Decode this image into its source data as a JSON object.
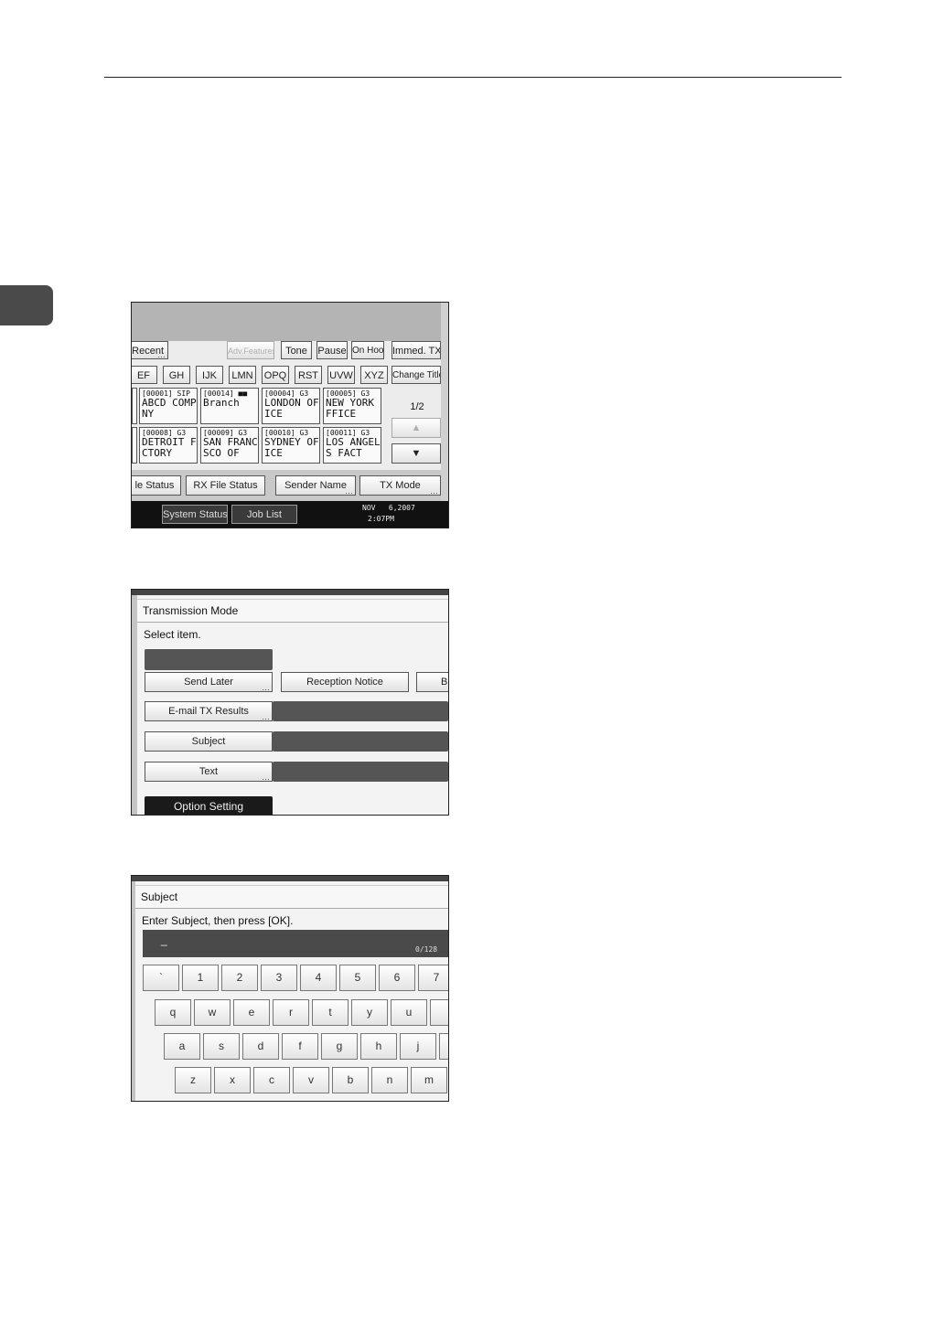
{
  "screen1": {
    "tabs": [
      "Recent",
      "Adv.Features",
      "Tone",
      "Pause",
      "On Hook",
      "Immed. TX"
    ],
    "letters": [
      "EF",
      "GH",
      "IJK",
      "LMN",
      "OPQ",
      "RST",
      "UVW",
      "XYZ",
      "Change Title"
    ],
    "destinations": [
      {
        "code": "[00001] SIP",
        "name1": "ABCD COMPA",
        "name2": "NY"
      },
      {
        "code": "[00014]",
        "name1": "Branch",
        "name2": ""
      },
      {
        "code": "[00004] G3",
        "name1": "LONDON OFF",
        "name2": "ICE"
      },
      {
        "code": "[00005] G3",
        "name1": "NEW YORK O",
        "name2": "FFICE"
      },
      {
        "code": "[00008] G3",
        "name1": "DETROIT FA",
        "name2": "CTORY"
      },
      {
        "code": "[00009] G3",
        "name1": "SAN FRANCI",
        "name2": "SCO OF"
      },
      {
        "code": "[00010] G3",
        "name1": "SYDNEY OFF",
        "name2": "ICE"
      },
      {
        "code": "[00011] G3",
        "name1": "LOS ANGELE",
        "name2": "S FACT"
      }
    ],
    "page_indicator": "1/2",
    "bottom_buttons": [
      "le Status",
      "RX File Status",
      "Sender Name",
      "TX Mode"
    ],
    "footer_buttons": [
      "System Status",
      "Job List"
    ],
    "date": "NOV   6,2007",
    "time": "2:07PM"
  },
  "screen2": {
    "title": "Transmission Mode",
    "instruction": "Select item.",
    "send_later": "Send Later",
    "reception_notice": "Reception Notice",
    "partial": "B",
    "email_tx_results": "E-mail TX Results",
    "subject": "Subject",
    "text": "Text",
    "option_setting": "Option Setting"
  },
  "screen3": {
    "title": "Subject",
    "instruction": "Enter Subject, then press [OK].",
    "cursor": "_",
    "counter": "0/128",
    "row1": [
      "`",
      "1",
      "2",
      "3",
      "4",
      "5",
      "6",
      "7"
    ],
    "row2": [
      "q",
      "w",
      "e",
      "r",
      "t",
      "y",
      "u",
      ""
    ],
    "row3": [
      "a",
      "s",
      "d",
      "f",
      "g",
      "h",
      "j",
      ""
    ],
    "row4": [
      "z",
      "x",
      "c",
      "v",
      "b",
      "n",
      "m"
    ]
  }
}
